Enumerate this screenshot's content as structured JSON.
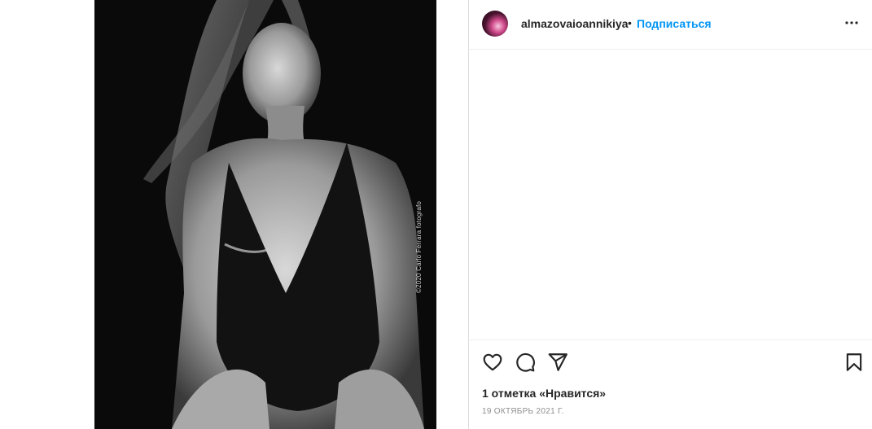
{
  "post": {
    "photo": {
      "alt": "",
      "credit": "©2020 Carlo Ferrara fotografo"
    },
    "header": {
      "username": "almazovaioannikiya",
      "separator": "•",
      "follow_label": "Подписаться",
      "more_icon": "more-horizontal-icon"
    },
    "actions": {
      "like_icon": "heart-icon",
      "comment_icon": "comment-icon",
      "share_icon": "paper-plane-icon",
      "save_icon": "bookmark-icon"
    },
    "likes_text": "1 отметка «Нравится»",
    "date_text": "19 ОКТЯБРЬ 2021 Г."
  },
  "colors": {
    "accent": "#0095f6",
    "text": "#262626",
    "muted": "#8e8e8e",
    "border": "#dbdbdb"
  }
}
